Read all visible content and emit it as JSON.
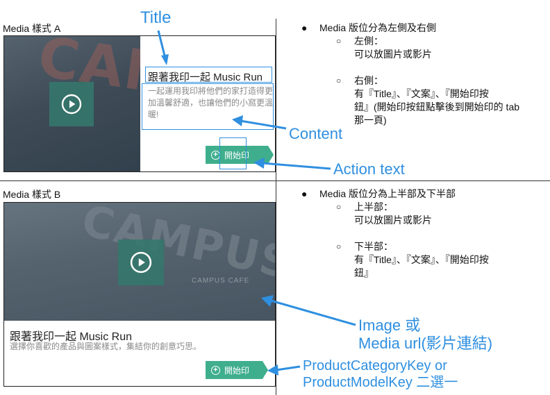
{
  "section_a": {
    "heading": "Media 樣式 A",
    "card": {
      "title": "跟著我印一起 Music Run",
      "content": "一起運用我印將他們的家打造得更加溫馨舒適，也讓他們的小窩更溫暖!",
      "action_label": "開始印"
    },
    "bullet": "Media 版位分為左側及右側",
    "items": [
      {
        "label": "左側：",
        "desc": "可以放圖片或影片"
      },
      {
        "label": "右側：",
        "desc_lines": [
          "有『Title』、『文案』、『開始印按",
          "鈕』(開始印按鈕點擊後到開始印的 tab",
          "那一頁)"
        ]
      }
    ]
  },
  "section_b": {
    "heading": "Media 樣式 B",
    "card": {
      "title": "跟著我印一起 Music Run",
      "content": "選擇你喜歡的產品與圖案樣式，集結你的創意巧思。",
      "action_label": "開始印"
    },
    "bullet": "Media 版位分為上半部及下半部",
    "items": [
      {
        "label": "上半部：",
        "desc": "可以放圖片或影片"
      },
      {
        "label": "下半部：",
        "desc_lines": [
          "有『Title』、『文案』、『開始印按",
          "鈕』"
        ]
      }
    ]
  },
  "annotations": {
    "title": "Title",
    "content": "Content",
    "action_text": "Action text",
    "image_line1": "Image 或",
    "image_line2": "Media url(影片連結)",
    "product_line1": "ProductCategoryKey or",
    "product_line2": "ProductModelKey 二選一"
  },
  "background_text": {
    "campus_big": "CAMPUS",
    "campus_cafe": "CAMPUS CAFE"
  },
  "colors": {
    "accent_green": "#3fae8c",
    "annotation_blue": "#2f8fe0",
    "play_box": "#34786c"
  },
  "icons": [
    "play-icon",
    "plus-circle-icon",
    "bullet-dot",
    "bullet-circle"
  ]
}
